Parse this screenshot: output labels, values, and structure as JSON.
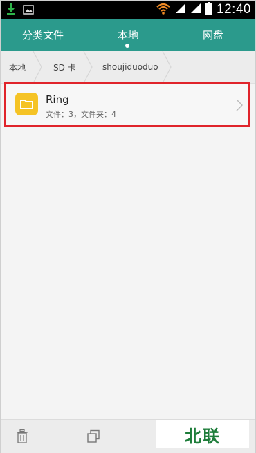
{
  "status_bar": {
    "time": "12:40",
    "icons": [
      "download-icon",
      "image-icon",
      "wifi-icon",
      "signal-icon",
      "signal-icon",
      "battery-icon"
    ]
  },
  "tabs": [
    {
      "label": "分类文件"
    },
    {
      "label": "本地"
    },
    {
      "label": "网盘"
    }
  ],
  "breadcrumb": [
    "本地",
    "SD 卡",
    "shoujiduoduo"
  ],
  "list": {
    "items": [
      {
        "title": "Ring",
        "subtitle": "文件：3，文件夹：4"
      }
    ]
  },
  "bottom_bar": {
    "icons": [
      "trash-icon",
      "copy-icon"
    ]
  },
  "watermark": "北联",
  "colors": {
    "accent": "#2b9a8c",
    "highlight_border": "#e0242b",
    "folder": "#f5c325",
    "watermark_text": "#1e7d3a"
  }
}
